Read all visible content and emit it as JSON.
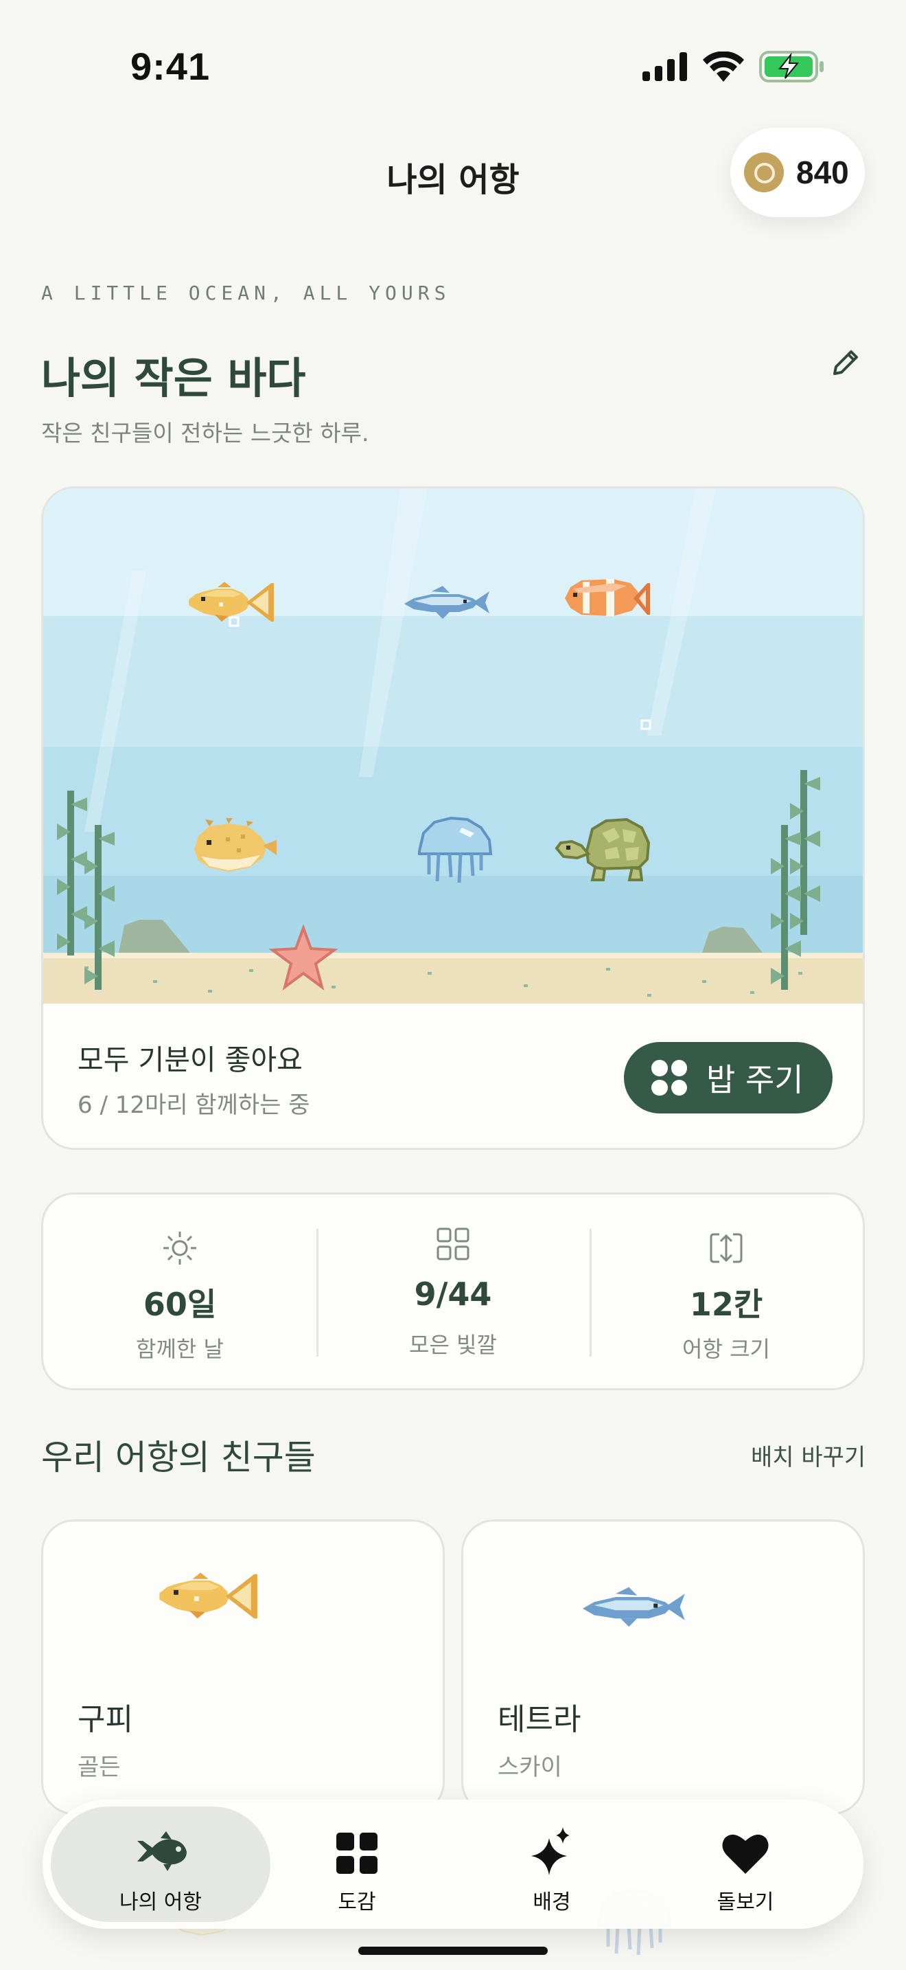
{
  "status_bar": {
    "time": "9:41"
  },
  "nav": {
    "title": "나의 어항",
    "coins": "840"
  },
  "hero": {
    "eyebrow": "A LITTLE OCEAN, ALL YOURS",
    "title": "나의 작은 바다",
    "subtitle": "작은 친구들이 전하는 느긋한 하루."
  },
  "aquarium": {
    "mood": "모두 기분이 좋아요",
    "count": "6 / 12마리 함께하는 중",
    "feed_label": "밥 주기",
    "inhabitants": [
      "goldfish",
      "blue-fish",
      "clownfish",
      "pufferfish",
      "jellyfish",
      "turtle",
      "starfish"
    ]
  },
  "stats": [
    {
      "icon": "sun-icon",
      "value": "60일",
      "label": "함께한 날"
    },
    {
      "icon": "grid-icon",
      "value": "9/44",
      "label": "모은 빛깔"
    },
    {
      "icon": "resize-icon",
      "value": "12칸",
      "label": "어항 크기"
    }
  ],
  "friends": {
    "title": "우리 어항의 친구들",
    "action": "배치 바꾸기",
    "items": [
      {
        "name": "구피",
        "variety": "골든",
        "sprite": "goldfish"
      },
      {
        "name": "테트라",
        "variety": "스카이",
        "sprite": "blue-fish"
      }
    ]
  },
  "tabs": [
    {
      "label": "나의 어항",
      "icon": "fish-icon",
      "active": true
    },
    {
      "label": "도감",
      "icon": "grid-icon",
      "active": false
    },
    {
      "label": "배경",
      "icon": "sparkle-icon",
      "active": false
    },
    {
      "label": "돌보기",
      "icon": "heart-icon",
      "active": false
    }
  ],
  "colors": {
    "accent": "#355a47",
    "headline": "#2f4a3d",
    "coin": "#c4a35e",
    "water_top": "#dcf1f8",
    "water_bottom": "#a9d9e9",
    "sand": "#ede1bd"
  }
}
